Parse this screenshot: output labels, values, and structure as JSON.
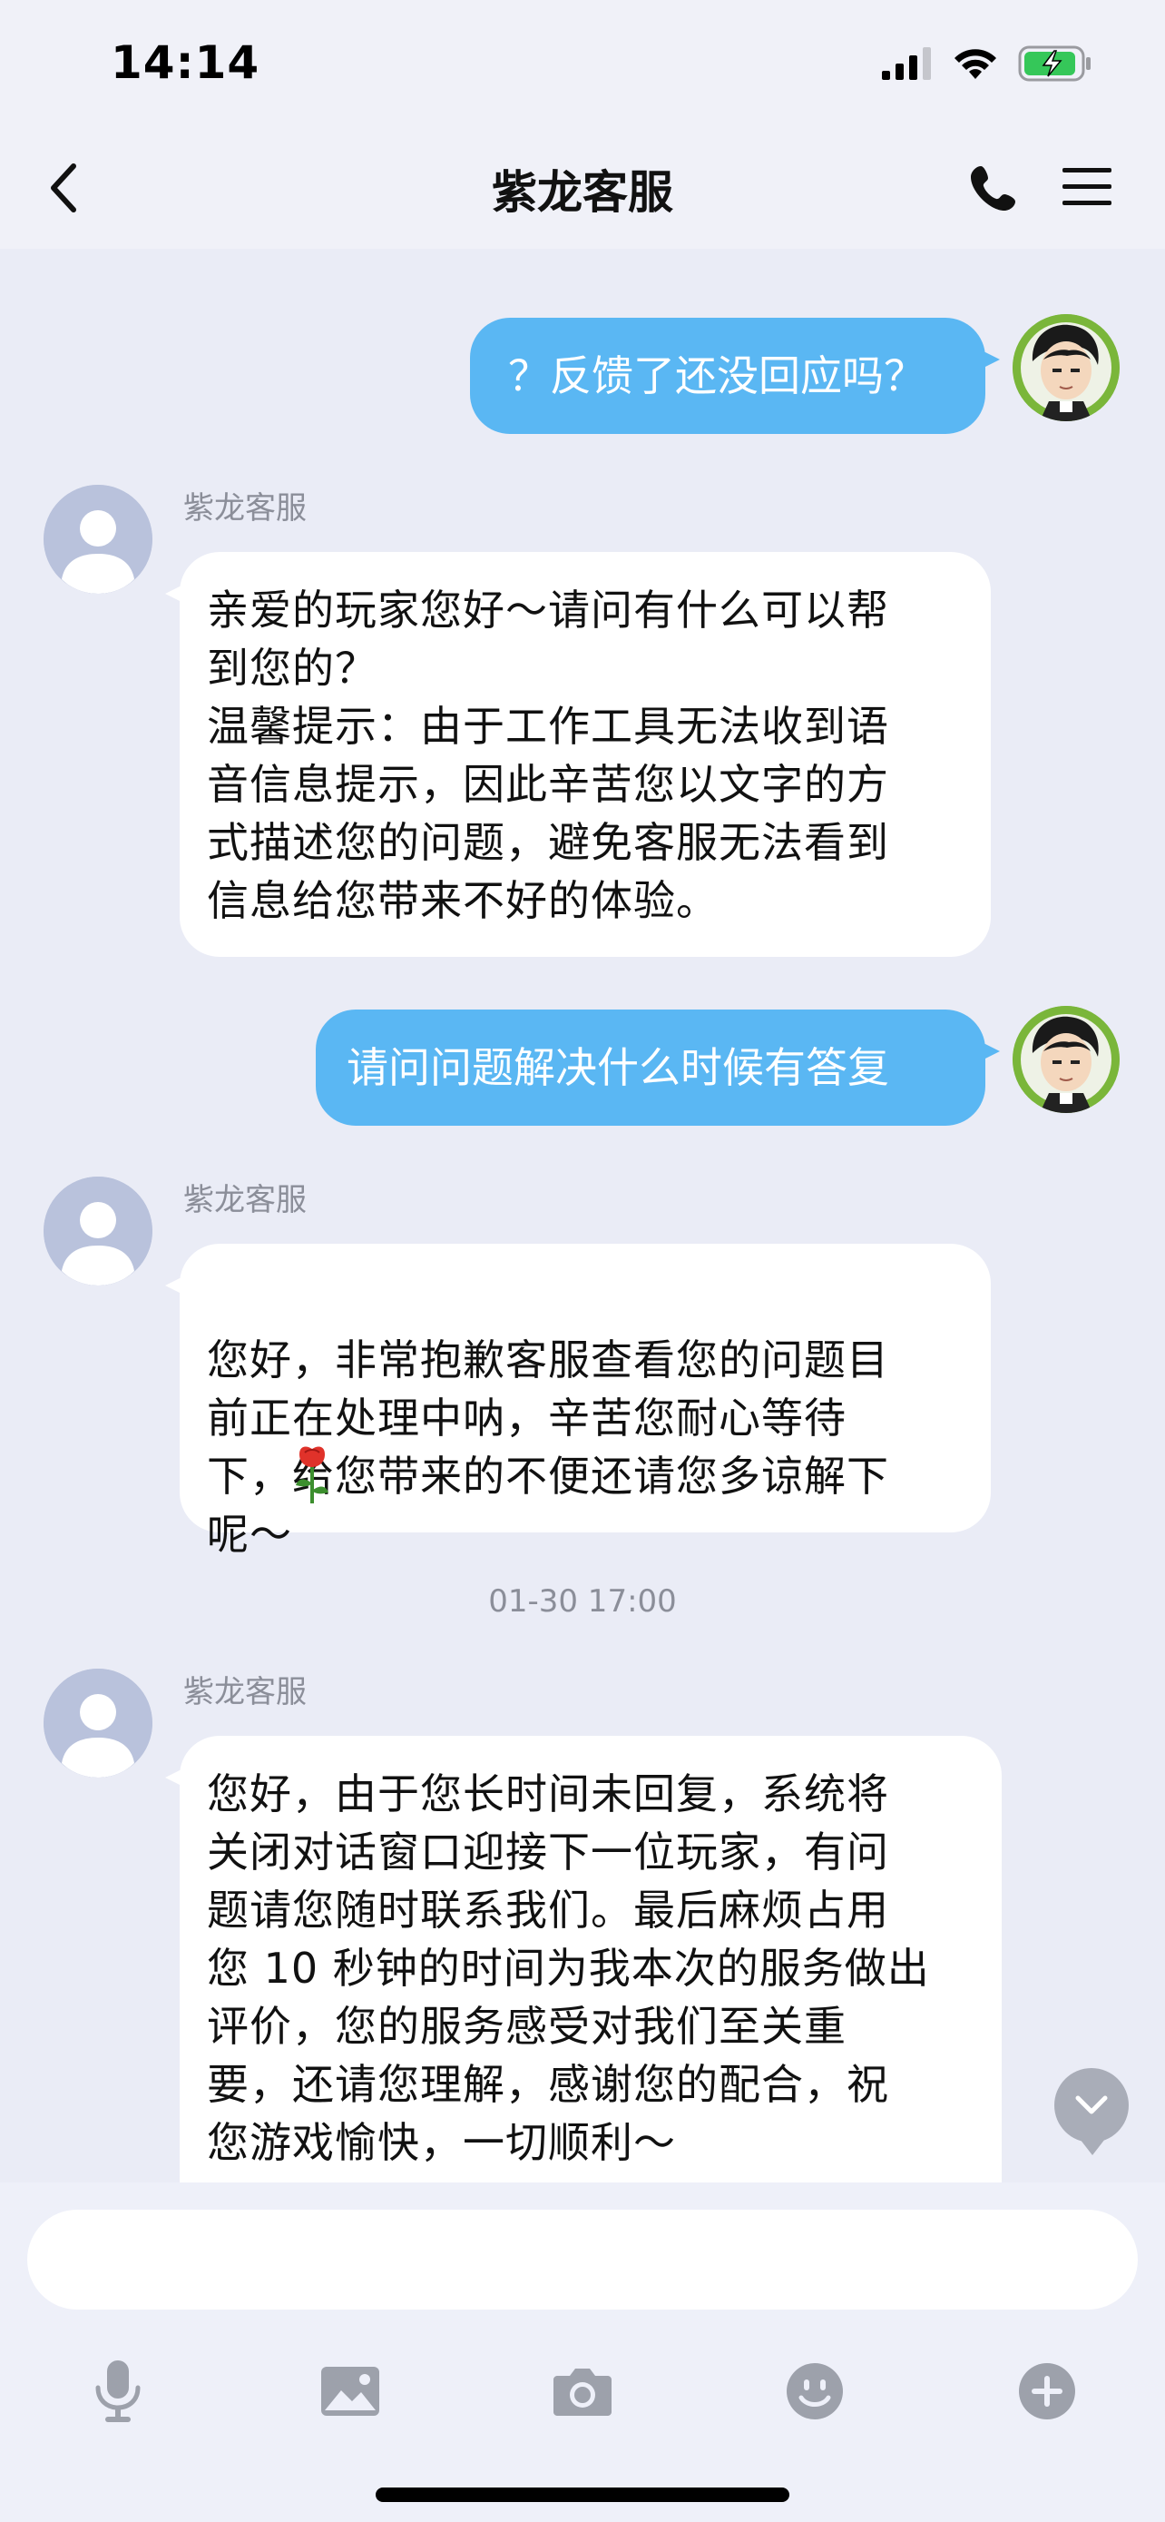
{
  "status_bar": {
    "time": "14:14"
  },
  "header": {
    "title": "紫龙客服"
  },
  "messages": {
    "m1": {
      "text": "？反馈了还没回应吗？"
    },
    "m2": {
      "sender": "紫龙客服",
      "text": "亲爱的玩家您好～请问有什么可以帮\n到您的？\n温馨提示：由于工作工具无法收到语\n音信息提示，因此辛苦您以文字的方\n式描述您的问题，避免客服无法看到\n信息给您带来不好的体验。"
    },
    "m3": {
      "text": "请问问题解决什么时候有答复"
    },
    "m4": {
      "sender": "紫龙客服",
      "text": "您好，非常抱歉客服查看您的问题目\n前正在处理中呐，辛苦您耐心等待\n下，给您带来的不便还请您多谅解下\n呢～"
    },
    "timestamp": "01-30 17:00",
    "m5": {
      "sender": "紫龙客服",
      "text": "您好，由于您长时间未回复，系统将\n关闭对话窗口迎接下一位玩家，有问\n题请您随时联系我们。最后麻烦占用\n您 10 秒钟的时间为我本次的服务做出\n评价，您的服务感受对我们至关重\n要，还请您理解，感谢您的配合，祝\n您游戏愉快，一切顺利～"
    }
  },
  "input": {
    "placeholder": ""
  },
  "toolbar_icons": [
    "microphone-icon",
    "image-icon",
    "camera-icon",
    "emoji-icon",
    "plus-icon"
  ],
  "colors": {
    "outgoing_bubble": "#5ab7f3",
    "incoming_bubble": "#ffffff",
    "background": "#eaecf6",
    "user_avatar": "#7ab63a",
    "agent_avatar": "#b9c2dc"
  }
}
